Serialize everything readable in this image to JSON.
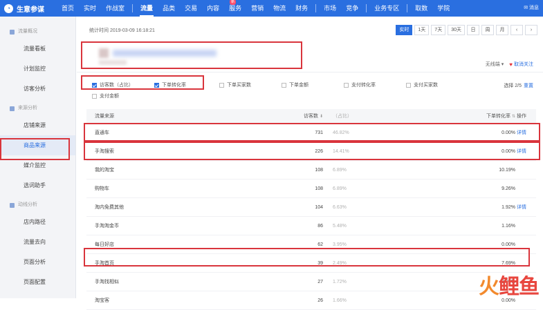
{
  "nav": {
    "brand": "生意参谋",
    "items": [
      "首页",
      "实时",
      "作战室",
      "流量",
      "品类",
      "交易",
      "内容",
      "服务",
      "营销",
      "物流",
      "财务",
      "市场",
      "竞争",
      "业务专区",
      "取数",
      "学院"
    ],
    "active_index": 3,
    "badge_label": "新",
    "message": "消息"
  },
  "sidebar": {
    "groups": [
      {
        "label": "流量概况",
        "items": [
          "流量看板",
          "计划监控",
          "访客分析"
        ]
      },
      {
        "label": "来源分析",
        "items": [
          "店铺来源",
          "商品来源",
          "媒介监控",
          "选词助手"
        ]
      },
      {
        "label": "动线分析",
        "items": [
          "店内路径",
          "流量去向",
          "页面分析",
          "页面配置"
        ]
      }
    ],
    "selected": "商品来源"
  },
  "toolbar": {
    "timestamp": "统计时间 2019-03-09 16:18:21",
    "periods": [
      "实时",
      "1天",
      "7天",
      "30天",
      "日",
      "周",
      "月"
    ],
    "active_period": "实时",
    "prev": "‹",
    "next": "›"
  },
  "follow": {
    "dropdown": "无线端 ▾",
    "label": "取消关注"
  },
  "metrics": {
    "options": [
      {
        "label": "访客数（占比）",
        "checked": true
      },
      {
        "label": "下单转化率",
        "checked": true
      },
      {
        "label": "下单买家数",
        "checked": false
      },
      {
        "label": "下单金额",
        "checked": false
      },
      {
        "label": "支付转化率",
        "checked": false
      },
      {
        "label": "支付买家数",
        "checked": false
      },
      {
        "label": "支付金额",
        "checked": false
      }
    ],
    "selected_count": "选择 2/5",
    "reset": "重置"
  },
  "table": {
    "headers": {
      "source": "流量来源",
      "visitors": "访客数",
      "share": "（占比）",
      "rate": "下单转化率",
      "action": "操作"
    },
    "rows": [
      {
        "source": "直通车",
        "visitors": "731",
        "share": "46.82%",
        "rate": "0.00%",
        "action": "详情"
      },
      {
        "source": "手淘搜索",
        "visitors": "226",
        "share": "14.41%",
        "rate": "0.00%",
        "action": "详情"
      },
      {
        "source": "我的淘宝",
        "visitors": "108",
        "share": "6.89%",
        "rate": "10.19%",
        "action": ""
      },
      {
        "source": "购物车",
        "visitors": "108",
        "share": "6.89%",
        "rate": "9.26%",
        "action": ""
      },
      {
        "source": "淘内免费其他",
        "visitors": "104",
        "share": "6.63%",
        "rate": "1.92%",
        "action": "详情"
      },
      {
        "source": "手淘淘金币",
        "visitors": "86",
        "share": "5.48%",
        "rate": "1.16%",
        "action": ""
      },
      {
        "source": "每日好店",
        "visitors": "62",
        "share": "3.95%",
        "rate": "0.00%",
        "action": ""
      },
      {
        "source": "手淘首页",
        "visitors": "39",
        "share": "2.49%",
        "rate": "7.69%",
        "action": ""
      },
      {
        "source": "手淘找相似",
        "visitors": "27",
        "share": "1.72%",
        "rate": "0.00%",
        "action": ""
      },
      {
        "source": "淘宝客",
        "visitors": "26",
        "share": "1.66%",
        "rate": "0.00%",
        "action": ""
      }
    ]
  },
  "watermark": {
    "part1": "火",
    "part2": "鲤鱼"
  }
}
